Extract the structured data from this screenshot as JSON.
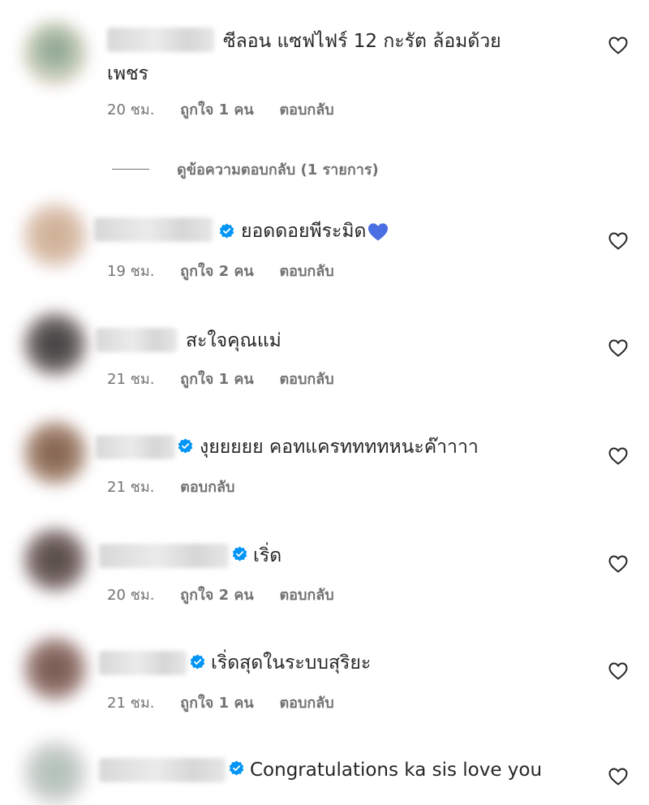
{
  "comments": [
    {
      "text_line1": "ซีลอน แซฟไฟร์ 12 กะรัต ล้อมด้วย",
      "text_line2": "เพชร",
      "time": "20 ชม.",
      "likes": "ถูกใจ 1 คน",
      "reply": "ตอบกลับ",
      "verified": false
    },
    {
      "text": "ยอดดอยพีระมิด",
      "emoji": "blue-heart-icon",
      "time": "19 ชม.",
      "likes": "ถูกใจ 2 คน",
      "reply": "ตอบกลับ",
      "verified": true
    },
    {
      "text": "สะใจคุณแม่",
      "time": "21 ชม.",
      "likes": "ถูกใจ 1 คน",
      "reply": "ตอบกลับ",
      "verified": false
    },
    {
      "text": "งุยยยยย คอทแครททททหนะค๊าาาา",
      "time": "21 ชม.",
      "reply": "ตอบกลับ",
      "verified": true
    },
    {
      "text": "เริ่ด",
      "time": "20 ชม.",
      "likes": "ถูกใจ 2 คน",
      "reply": "ตอบกลับ",
      "verified": true
    },
    {
      "text": "เริ่ดสุดในระบบสุริยะ",
      "time": "21 ชม.",
      "likes": "ถูกใจ 1 คน",
      "reply": "ตอบกลับ",
      "verified": true
    },
    {
      "text": "Congratulations ka sis love you",
      "verified": true
    }
  ],
  "view_replies_label": "ดูข้อความตอบกลับ (1 รายการ)",
  "icons": {
    "like": "heart-outline-icon",
    "verified": "verified-badge-icon",
    "emoji": "blue-heart-icon"
  },
  "colors": {
    "verified_blue": "#0095f6",
    "meta_gray": "#737373",
    "text": "#262626",
    "emoji_blue": "#4a6fe3"
  }
}
